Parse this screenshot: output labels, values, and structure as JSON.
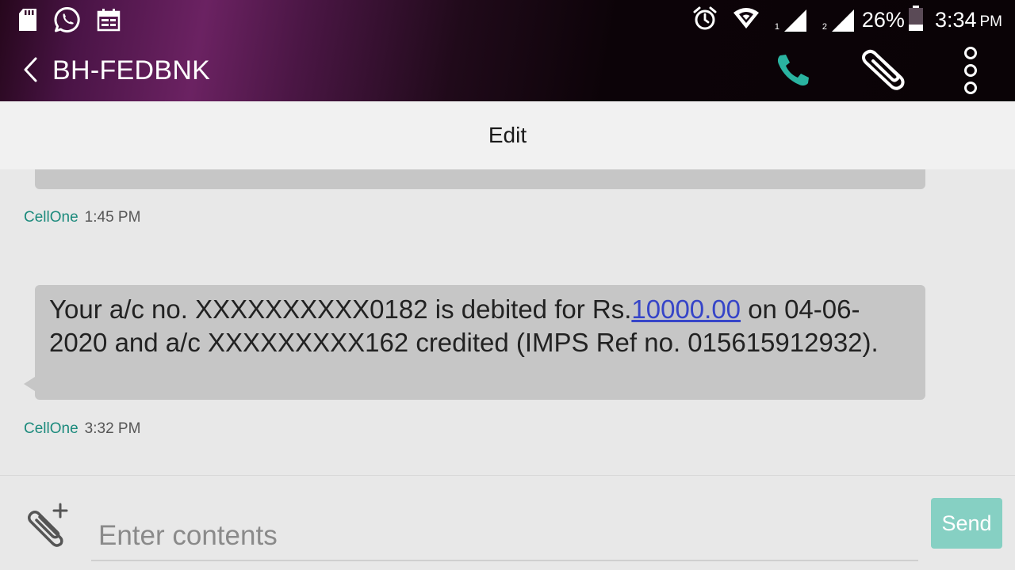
{
  "status_bar": {
    "left_icons": [
      "sd-card-icon",
      "whatsapp-icon",
      "calendar-icon"
    ],
    "right_icons": [
      "alarm-icon",
      "wifi-icon",
      "signal-sim1-icon",
      "signal-sim2-icon",
      "battery-icon"
    ],
    "sim1_label": "1",
    "sim2_label": "2",
    "battery": "26%",
    "time": "3:34",
    "ampm": "PM"
  },
  "header": {
    "back_icon": "back-chevron-icon",
    "title": "BH-FEDBNK",
    "call_icon": "phone-icon",
    "attach_icon": "paperclip-icon",
    "more_icon": "more-vertical-icon"
  },
  "edit_bar": {
    "label": "Edit"
  },
  "conversation": {
    "messages": [
      {
        "sender": "CellOne",
        "time": "1:45 PM"
      },
      {
        "text_before": "Your a/c no. XXXXXXXXXX0182 is debited for Rs.",
        "amount": "10000.00",
        "text_after": " on 04-06-2020 and a/c XXXXXXXXX162 credited (IMPS Ref no. 015615912932).",
        "sender": "CellOne",
        "time": "3:32 PM"
      }
    ]
  },
  "compose": {
    "attach_icon": "add-attachment-icon",
    "placeholder": "Enter contents",
    "send_label": "Send"
  },
  "colors": {
    "accent": "#1b8a7c",
    "send_button": "#86d0c3",
    "link": "#3645c8",
    "bubble": "#c6c6c6",
    "call_icon": "#2ab3a0"
  }
}
